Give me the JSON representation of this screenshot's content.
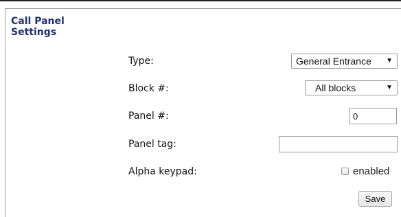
{
  "section": {
    "title": "Call Panel Settings"
  },
  "fields": {
    "type": {
      "label": "Type:",
      "selected": "General Entrance"
    },
    "block": {
      "label": "Block #:",
      "selected": "All blocks"
    },
    "panel_number": {
      "label": "Panel #:",
      "value": "0"
    },
    "panel_tag": {
      "label": "Panel tag:",
      "value": ""
    },
    "alpha_keypad": {
      "label": "Alpha keypad:",
      "checkbox_label": "enabled",
      "checked": false
    }
  },
  "actions": {
    "save_label": "Save"
  },
  "icons": {
    "select_caret": "caret-down-icon"
  },
  "colors": {
    "section_title": "#1f2f7a",
    "topbar": "#222222",
    "border": "#9a9a9a"
  }
}
